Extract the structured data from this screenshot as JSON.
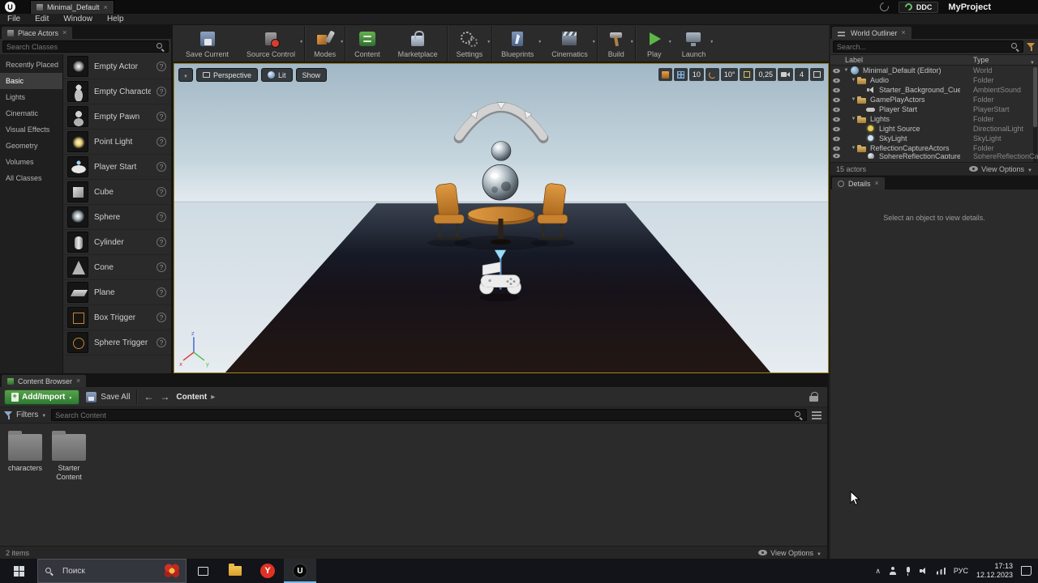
{
  "window": {
    "tab_title": "Minimal_Default",
    "ddc_label": "DDC",
    "project_title": "MyProject",
    "menu_items": [
      "File",
      "Edit",
      "Window",
      "Help"
    ]
  },
  "place_actors": {
    "tab_title": "Place Actors",
    "search_placeholder": "Search Classes",
    "categories": [
      {
        "label": "Recently Placed",
        "cls": ""
      },
      {
        "label": "Basic",
        "cls": "selected"
      },
      {
        "label": "Lights",
        "cls": ""
      },
      {
        "label": "Cinematic",
        "cls": ""
      },
      {
        "label": "Visual Effects",
        "cls": ""
      },
      {
        "label": "Geometry",
        "cls": ""
      },
      {
        "label": "Volumes",
        "cls": ""
      },
      {
        "label": "All Classes",
        "cls": ""
      }
    ],
    "items": [
      {
        "label": "Empty Actor",
        "thumb": "th-actor"
      },
      {
        "label": "Empty Character",
        "thumb": "th-character"
      },
      {
        "label": "Empty Pawn",
        "thumb": "th-pawn"
      },
      {
        "label": "Point Light",
        "thumb": "th-pointlight"
      },
      {
        "label": "Player Start",
        "thumb": "th-playerstart"
      },
      {
        "label": "Cube",
        "thumb": "th-cube"
      },
      {
        "label": "Sphere",
        "thumb": "th-sphere"
      },
      {
        "label": "Cylinder",
        "thumb": "th-cylinder"
      },
      {
        "label": "Cone",
        "thumb": "th-cone"
      },
      {
        "label": "Plane",
        "thumb": "th-plane"
      },
      {
        "label": "Box Trigger",
        "thumb": "th-boxtrigger"
      },
      {
        "label": "Sphere Trigger",
        "thumb": "th-spheretrigger"
      }
    ]
  },
  "toolbar": {
    "buttons": [
      {
        "label": "Save Current",
        "icon": "save-icon",
        "name": "save-current-button",
        "cls": "",
        "caret": ""
      },
      {
        "label": "Source Control",
        "icon": "source-control-icon",
        "name": "source-control-button",
        "cls": "sep-after",
        "caret": "with-caret"
      },
      {
        "label": "Modes",
        "icon": "modes-icon",
        "name": "modes-button",
        "cls": "sep-after",
        "caret": "with-caret"
      },
      {
        "label": "Content",
        "icon": "content-icon",
        "name": "content-button",
        "cls": "",
        "caret": ""
      },
      {
        "label": "Marketplace",
        "icon": "marketplace-icon",
        "name": "marketplace-button",
        "cls": "sep-after",
        "caret": ""
      },
      {
        "label": "Settings",
        "icon": "settings-icon",
        "name": "settings-button",
        "cls": "sep-after",
        "caret": "with-caret"
      },
      {
        "label": "Blueprints",
        "icon": "blueprints-icon",
        "name": "blueprints-button",
        "cls": "",
        "caret": "with-caret"
      },
      {
        "label": "Cinematics",
        "icon": "cinematics-icon",
        "name": "cinematics-button",
        "cls": "sep-after",
        "caret": "with-caret"
      },
      {
        "label": "Build",
        "icon": "build-icon",
        "name": "build-button",
        "cls": "sep-after",
        "caret": "with-caret"
      },
      {
        "label": "Play",
        "icon": "play-icon",
        "name": "play-button",
        "cls": "",
        "caret": "with-caret"
      },
      {
        "label": "Launch",
        "icon": "launch-icon",
        "name": "launch-button",
        "cls": "",
        "caret": "with-caret"
      }
    ]
  },
  "viewport": {
    "perspective_label": "Perspective",
    "lit_label": "Lit",
    "show_label": "Show",
    "grid_snap_value": "10",
    "rotation_snap_value": "10°",
    "scale_snap_value": "0,25",
    "camera_speed_value": "4"
  },
  "world_outliner": {
    "tab_title": "World Outliner",
    "search_placeholder": "Search...",
    "label_column": "Label",
    "type_column": "Type",
    "rows": [
      {
        "ind": "ind-0",
        "exp": "exp",
        "icon": "world-icon",
        "label": "Minimal_Default (Editor)",
        "type": "World"
      },
      {
        "ind": "ind-1",
        "exp": "exp",
        "icon": "folder-icon",
        "label": "Audio",
        "type": "Folder"
      },
      {
        "ind": "ind-2",
        "exp": "",
        "icon": "sound-icon",
        "label": "Starter_Background_Cue",
        "type": "AmbientSound"
      },
      {
        "ind": "ind-1",
        "exp": "exp",
        "icon": "folder-icon",
        "label": "GamePlayActors",
        "type": "Folder"
      },
      {
        "ind": "ind-2",
        "exp": "",
        "icon": "gamepad-icon",
        "label": "Player Start",
        "type": "PlayerStart"
      },
      {
        "ind": "ind-1",
        "exp": "exp",
        "icon": "folder-icon",
        "label": "Lights",
        "type": "Folder"
      },
      {
        "ind": "ind-2",
        "exp": "",
        "icon": "dirlight-icon",
        "label": "Light Source",
        "type": "DirectionalLight"
      },
      {
        "ind": "ind-2",
        "exp": "",
        "icon": "skylight-icon",
        "label": "SkyLight",
        "type": "SkyLight"
      },
      {
        "ind": "ind-1",
        "exp": "exp",
        "icon": "folder-icon",
        "label": "ReflectionCaptureActors",
        "type": "Folder"
      },
      {
        "ind": "ind-2 cut",
        "exp": "",
        "icon": "sphere-icon",
        "label": "SphereReflectionCapture",
        "type": "SphereReflectionCapture"
      }
    ],
    "status": "15 actors",
    "view_options_label": "View Options"
  },
  "details": {
    "tab_title": "Details",
    "empty_message": "Select an object to view details."
  },
  "content_browser": {
    "tab_title": "Content Browser",
    "add_import_label": "Add/Import",
    "save_all_label": "Save All",
    "breadcrumb": "Content",
    "filters_label": "Filters",
    "search_placeholder": "Search Content",
    "folders": [
      {
        "label": "characters"
      },
      {
        "label": "Starter Content"
      }
    ],
    "status": "2 items",
    "view_options_label": "View Options"
  },
  "taskbar": {
    "search_label": "Поиск",
    "language": "РУС",
    "time": "17:13",
    "date": "12.12.2023"
  }
}
